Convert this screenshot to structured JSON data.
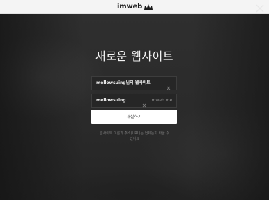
{
  "brand": {
    "logo_text": "imweb",
    "logo_mark_icon": "imweb-crown-icon"
  },
  "modal": {
    "title": "새로운 웹사이트",
    "site_name_field": {
      "value": "mellowsuing님의 웹사이트",
      "clear_icon": "clear-x-icon"
    },
    "site_url_field": {
      "value": "mellowsuing",
      "suffix": ".imweb.me",
      "clear_icon": "clear-x-icon"
    },
    "submit_label": "개설하기",
    "helper_line1": "웹사이트 이름과 주소(URL)는 언제든지 바꿀 수",
    "helper_line2": "있어요",
    "close_icon": "close-icon"
  },
  "colors": {
    "overlay_background": "#2b2b2b",
    "topbar_background": "#f4f4f4",
    "field_background": "#262626",
    "button_background": "#ffffff",
    "title_text": "#f3f3f3",
    "helper_text": "#7a7a7a"
  }
}
